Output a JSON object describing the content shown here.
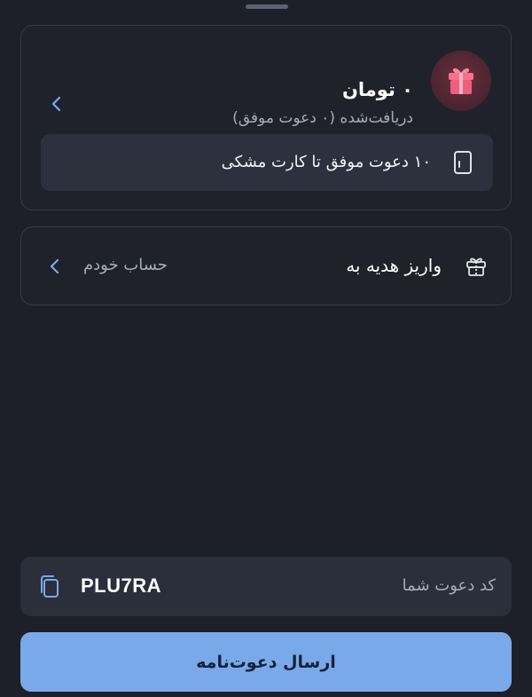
{
  "reward": {
    "amount": "۰ تومان",
    "subtitle": "دریافت‌شده (۰ دعوت موفق)",
    "progress_text": "۱۰ دعوت موفق تا کارت مشکی",
    "icon": "gift-icon",
    "progress_icon": "card-icon"
  },
  "deposit": {
    "label": "واریز هدیه به",
    "value": "حساب خودم",
    "icon": "gift-icon"
  },
  "invite": {
    "label": "کد دعوت شما",
    "code": "PLU7RA",
    "copy_icon": "copy-icon"
  },
  "actions": {
    "send_label": "ارسال دعوت‌نامه"
  },
  "colors": {
    "background": "#1d2029",
    "accent": "#7aa9ea",
    "gift_pink": "#f26a86"
  }
}
